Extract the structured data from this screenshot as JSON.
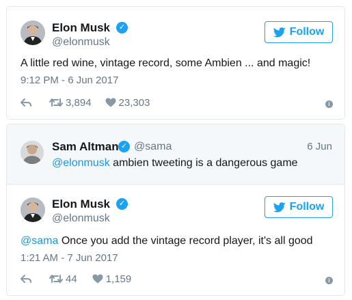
{
  "tweet1": {
    "name": "Elon Musk",
    "handle": "@elonmusk",
    "follow_label": "Follow",
    "text": "A little red wine, vintage record, some Ambien ... and magic!",
    "timestamp": "9:12 PM - 6 Jun 2017",
    "retweets": "3,894",
    "likes": "23,303"
  },
  "reply": {
    "name": "Sam Altman",
    "handle": "@sama",
    "date": "6 Jun",
    "mention": "@elonmusk",
    "text": " ambien tweeting is a dangerous game"
  },
  "tweet2": {
    "name": "Elon Musk",
    "handle": "@elonmusk",
    "follow_label": "Follow",
    "mention": "@sama",
    "text": " Once you add the vintage record player, it's all good",
    "timestamp": "1:21 AM - 7 Jun 2017",
    "retweets": "44",
    "likes": "1,159"
  },
  "colors": {
    "accent": "#1da1f2",
    "link": "#1b95e0",
    "muted": "#657786",
    "border": "#e1e8ed",
    "quote_bg": "#f5f8fa"
  },
  "icons": [
    "verified-badge-icon",
    "twitter-bird-icon",
    "reply-icon",
    "retweet-icon",
    "heart-icon",
    "info-icon"
  ]
}
